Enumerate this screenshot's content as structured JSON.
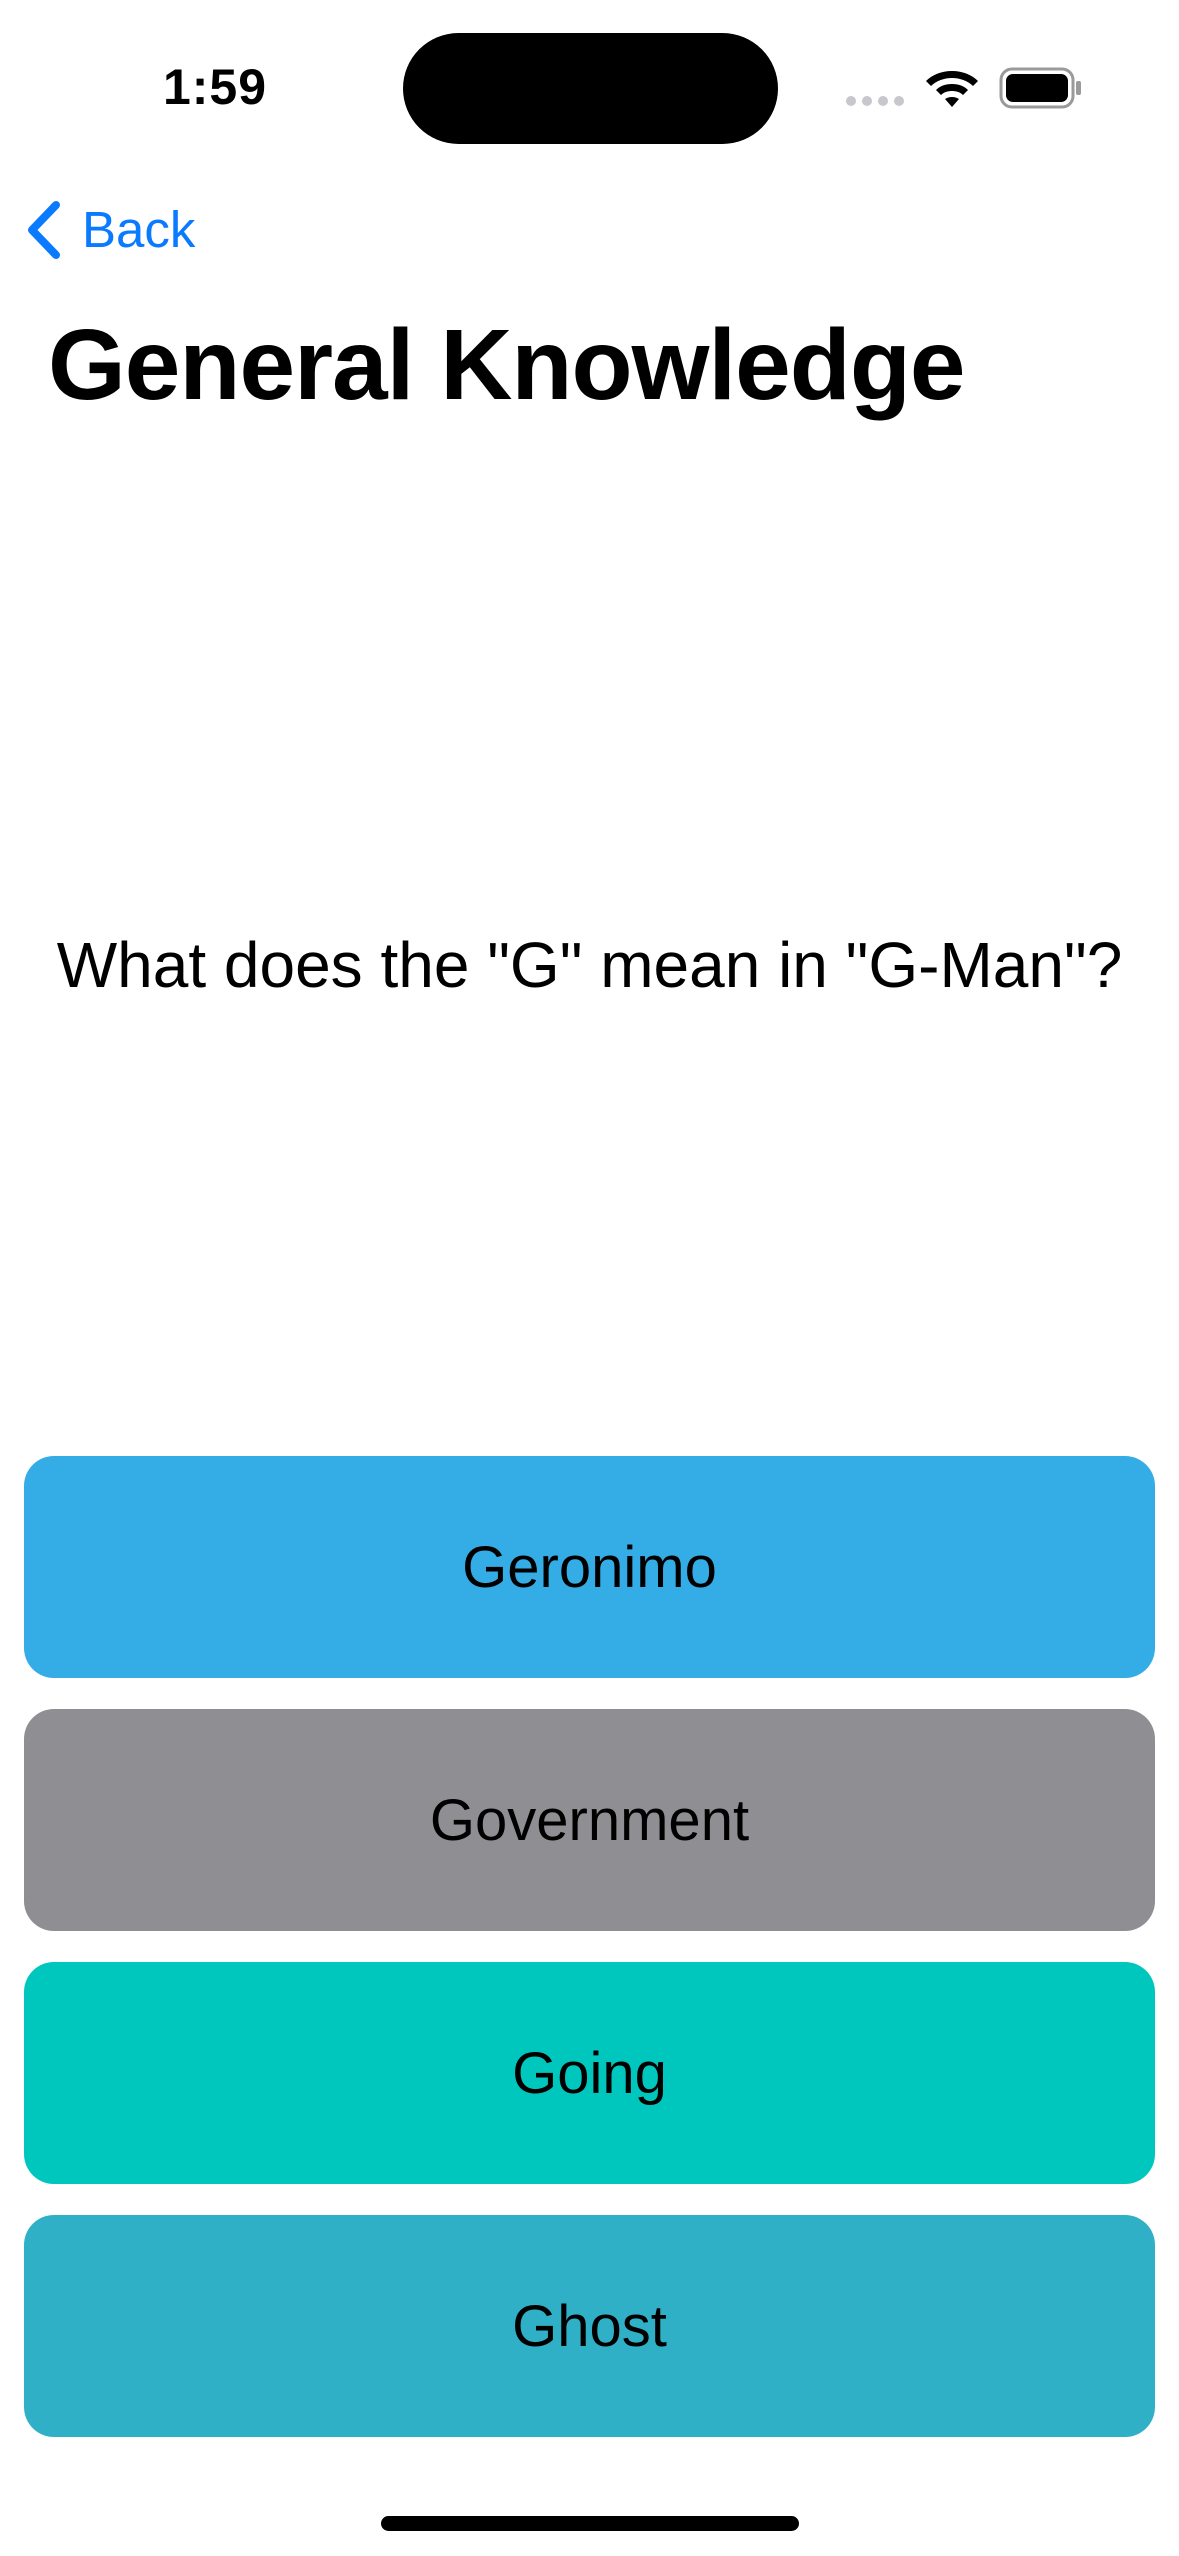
{
  "status_bar": {
    "time": "1:59"
  },
  "nav": {
    "back_label": "Back"
  },
  "page_title": "General Knowledge",
  "question": "What does the \"G\" mean in \"G-Man\"?",
  "answers": [
    {
      "label": "Geronimo",
      "color": "#34ace6"
    },
    {
      "label": "Government",
      "color": "#8e8e93"
    },
    {
      "label": "Going",
      "color": "#00c7be"
    },
    {
      "label": "Ghost",
      "color": "#30b0c7"
    }
  ],
  "colors": {
    "accent": "#0a7aff"
  }
}
